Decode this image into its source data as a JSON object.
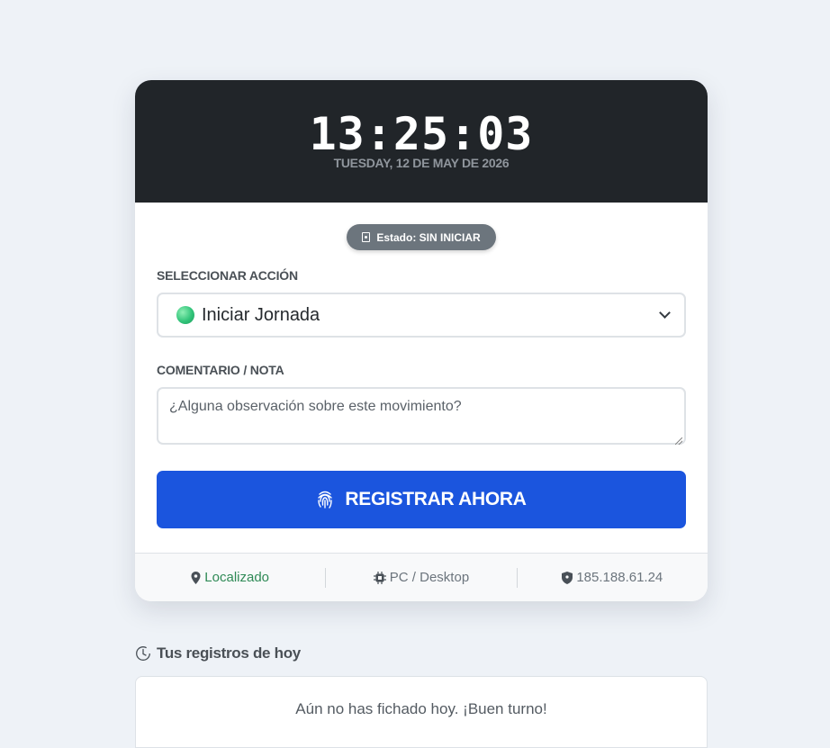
{
  "clock": {
    "time": "13:25:03",
    "date": "TUESDAY, 12 DE MAY DE 2026"
  },
  "status": {
    "label": "Estado: SIN INICIAR",
    "icon": "id-badge-icon",
    "color": "#6c757d"
  },
  "action": {
    "label": "SELECCIONAR ACCIÓN",
    "selected": "Iniciar Jornada",
    "indicator_color": "#32c47a"
  },
  "comment": {
    "label": "COMENTARIO / NOTA",
    "placeholder": "¿Alguna observación sobre este movimiento?"
  },
  "submit": {
    "label": "REGISTRAR AHORA",
    "icon": "fingerprint-icon",
    "color": "#1b55de"
  },
  "footer": {
    "location": "Localizado",
    "device": "PC / Desktop",
    "ip": "185.188.61.24"
  },
  "history": {
    "title": "Tus registros de hoy",
    "empty_message": "Aún no has fichado hoy. ¡Buen turno!"
  }
}
